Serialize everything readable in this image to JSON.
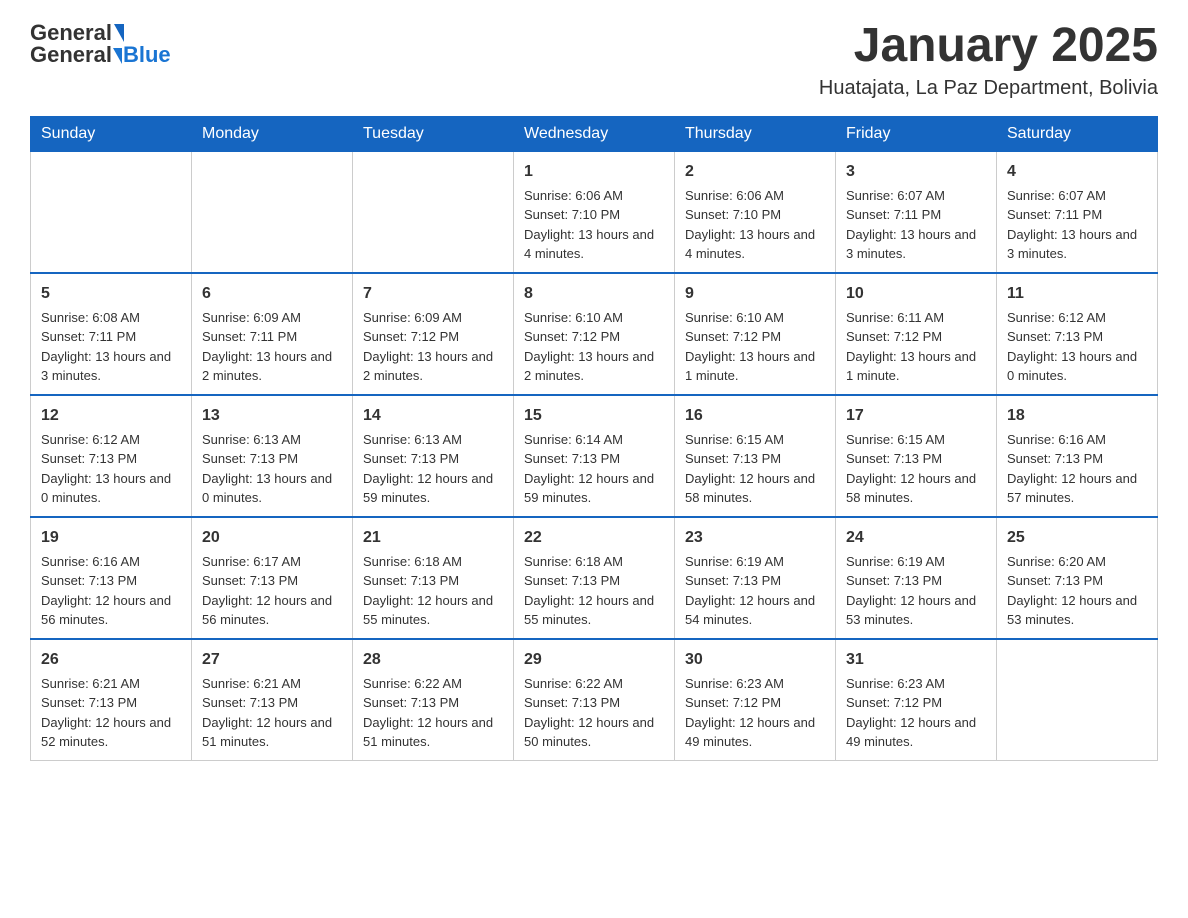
{
  "header": {
    "logo_general": "General",
    "logo_blue": "Blue",
    "month_title": "January 2025",
    "location": "Huatajata, La Paz Department, Bolivia"
  },
  "days_of_week": [
    "Sunday",
    "Monday",
    "Tuesday",
    "Wednesday",
    "Thursday",
    "Friday",
    "Saturday"
  ],
  "weeks": [
    [
      {
        "day": "",
        "info": ""
      },
      {
        "day": "",
        "info": ""
      },
      {
        "day": "",
        "info": ""
      },
      {
        "day": "1",
        "info": "Sunrise: 6:06 AM\nSunset: 7:10 PM\nDaylight: 13 hours and 4 minutes."
      },
      {
        "day": "2",
        "info": "Sunrise: 6:06 AM\nSunset: 7:10 PM\nDaylight: 13 hours and 4 minutes."
      },
      {
        "day": "3",
        "info": "Sunrise: 6:07 AM\nSunset: 7:11 PM\nDaylight: 13 hours and 3 minutes."
      },
      {
        "day": "4",
        "info": "Sunrise: 6:07 AM\nSunset: 7:11 PM\nDaylight: 13 hours and 3 minutes."
      }
    ],
    [
      {
        "day": "5",
        "info": "Sunrise: 6:08 AM\nSunset: 7:11 PM\nDaylight: 13 hours and 3 minutes."
      },
      {
        "day": "6",
        "info": "Sunrise: 6:09 AM\nSunset: 7:11 PM\nDaylight: 13 hours and 2 minutes."
      },
      {
        "day": "7",
        "info": "Sunrise: 6:09 AM\nSunset: 7:12 PM\nDaylight: 13 hours and 2 minutes."
      },
      {
        "day": "8",
        "info": "Sunrise: 6:10 AM\nSunset: 7:12 PM\nDaylight: 13 hours and 2 minutes."
      },
      {
        "day": "9",
        "info": "Sunrise: 6:10 AM\nSunset: 7:12 PM\nDaylight: 13 hours and 1 minute."
      },
      {
        "day": "10",
        "info": "Sunrise: 6:11 AM\nSunset: 7:12 PM\nDaylight: 13 hours and 1 minute."
      },
      {
        "day": "11",
        "info": "Sunrise: 6:12 AM\nSunset: 7:13 PM\nDaylight: 13 hours and 0 minutes."
      }
    ],
    [
      {
        "day": "12",
        "info": "Sunrise: 6:12 AM\nSunset: 7:13 PM\nDaylight: 13 hours and 0 minutes."
      },
      {
        "day": "13",
        "info": "Sunrise: 6:13 AM\nSunset: 7:13 PM\nDaylight: 13 hours and 0 minutes."
      },
      {
        "day": "14",
        "info": "Sunrise: 6:13 AM\nSunset: 7:13 PM\nDaylight: 12 hours and 59 minutes."
      },
      {
        "day": "15",
        "info": "Sunrise: 6:14 AM\nSunset: 7:13 PM\nDaylight: 12 hours and 59 minutes."
      },
      {
        "day": "16",
        "info": "Sunrise: 6:15 AM\nSunset: 7:13 PM\nDaylight: 12 hours and 58 minutes."
      },
      {
        "day": "17",
        "info": "Sunrise: 6:15 AM\nSunset: 7:13 PM\nDaylight: 12 hours and 58 minutes."
      },
      {
        "day": "18",
        "info": "Sunrise: 6:16 AM\nSunset: 7:13 PM\nDaylight: 12 hours and 57 minutes."
      }
    ],
    [
      {
        "day": "19",
        "info": "Sunrise: 6:16 AM\nSunset: 7:13 PM\nDaylight: 12 hours and 56 minutes."
      },
      {
        "day": "20",
        "info": "Sunrise: 6:17 AM\nSunset: 7:13 PM\nDaylight: 12 hours and 56 minutes."
      },
      {
        "day": "21",
        "info": "Sunrise: 6:18 AM\nSunset: 7:13 PM\nDaylight: 12 hours and 55 minutes."
      },
      {
        "day": "22",
        "info": "Sunrise: 6:18 AM\nSunset: 7:13 PM\nDaylight: 12 hours and 55 minutes."
      },
      {
        "day": "23",
        "info": "Sunrise: 6:19 AM\nSunset: 7:13 PM\nDaylight: 12 hours and 54 minutes."
      },
      {
        "day": "24",
        "info": "Sunrise: 6:19 AM\nSunset: 7:13 PM\nDaylight: 12 hours and 53 minutes."
      },
      {
        "day": "25",
        "info": "Sunrise: 6:20 AM\nSunset: 7:13 PM\nDaylight: 12 hours and 53 minutes."
      }
    ],
    [
      {
        "day": "26",
        "info": "Sunrise: 6:21 AM\nSunset: 7:13 PM\nDaylight: 12 hours and 52 minutes."
      },
      {
        "day": "27",
        "info": "Sunrise: 6:21 AM\nSunset: 7:13 PM\nDaylight: 12 hours and 51 minutes."
      },
      {
        "day": "28",
        "info": "Sunrise: 6:22 AM\nSunset: 7:13 PM\nDaylight: 12 hours and 51 minutes."
      },
      {
        "day": "29",
        "info": "Sunrise: 6:22 AM\nSunset: 7:13 PM\nDaylight: 12 hours and 50 minutes."
      },
      {
        "day": "30",
        "info": "Sunrise: 6:23 AM\nSunset: 7:12 PM\nDaylight: 12 hours and 49 minutes."
      },
      {
        "day": "31",
        "info": "Sunrise: 6:23 AM\nSunset: 7:12 PM\nDaylight: 12 hours and 49 minutes."
      },
      {
        "day": "",
        "info": ""
      }
    ]
  ]
}
